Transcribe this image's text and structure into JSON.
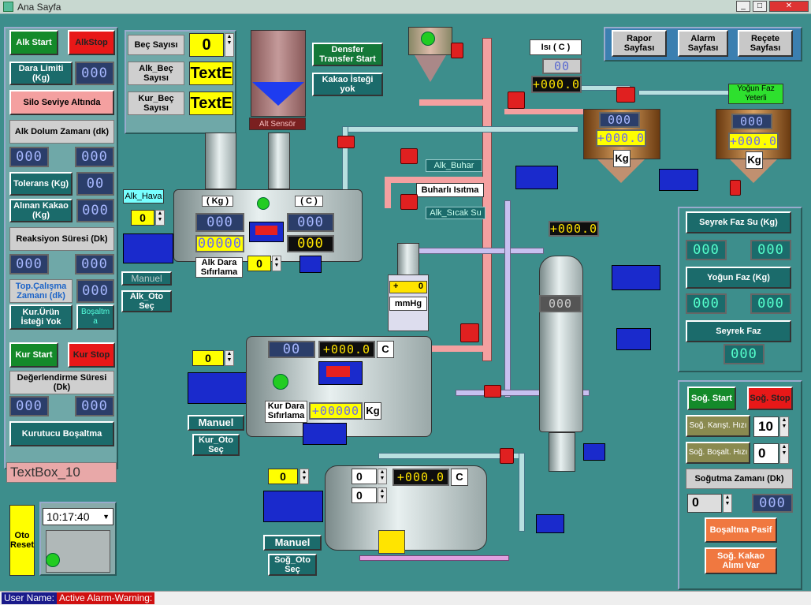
{
  "window": {
    "title": "Ana Sayfa",
    "min": "_",
    "max": "□",
    "close": "✕"
  },
  "left": {
    "alk_start": "Alk Start",
    "alk_stop": "AlkStop",
    "dara_limiti": "Dara Limiti (Kg)",
    "dara_limiti_val": "000",
    "silo_seviye": "Silo Seviye Altında",
    "alk_dolum": "Alk Dolum Zamanı (dk)",
    "alk_dolum_v1": "000",
    "alk_dolum_v2": "000",
    "tolerans": "Tolerans (Kg)",
    "tolerans_val": "00",
    "alinan_kakao": "Alınan Kakao (Kg)",
    "alinan_kakao_val": "000",
    "reaksiyon": "Reaksiyon Süresi (Dk)",
    "reaksiyon_v1": "000",
    "reaksiyon_v2": "000",
    "top_calisma": "Top.Çalışma Zamanı (dk)",
    "top_calisma_val": "000",
    "kur_urun": "Kur.Ürün İsteği Yok",
    "bosaltma_small": "Boşaltm a",
    "kur_start": "Kur Start",
    "kur_stop": "Kur Stop",
    "degerlendirme": "Değerlendirme Süresi (Dk)",
    "deger_v1": "000",
    "deger_v2": "000",
    "kurutucu": "Kurutucu Boşaltma",
    "textbox": "TextBox_10",
    "oto_reset": "Oto Reset",
    "time": "10:17:40"
  },
  "mid": {
    "bec_sayisi": "Beç Sayısı",
    "bec_val": "0",
    "alk_bec": "Alk_Beç Sayısı",
    "alk_bec_val": "TextE",
    "kur_bec": "Kur_Beç Sayısı",
    "kur_bec_val": "TextE",
    "alt_sensor": "Alt Sensör",
    "densfer": "Densfer Transfer Start",
    "kakao_istegi": "Kakao İsteği yok",
    "alk_hava": "Alk_Hava",
    "alk_hava_val": "0",
    "kg_label": "( Kg )",
    "c_label": "( C )",
    "kg_v1": "000",
    "kg_v2": "00000",
    "c_v1": "000",
    "c_v2": "000",
    "alk_dara": "Alk Dara Sıfırlama",
    "alk_dara_val": "0",
    "manuel1": "Manuel",
    "alk_oto": "Alk_Oto Seç",
    "alk_buhar": "Alk_Buhar",
    "buharli": "Buharlı Isıtma",
    "alk_sicak": "Alk_Sıcak Su",
    "mmhg_plus": "+",
    "mmhg_zero": "0",
    "mmhg": "mmHg",
    "kur_val": "0",
    "kur_v1": "00",
    "kur_temp": "+000.0",
    "kur_c": "C",
    "kur_dara": "Kur Dara Sıfırlama",
    "kur_weight": "+00000",
    "kur_kg": "Kg",
    "manuel2": "Manuel",
    "kur_oto": "Kur_Oto Seç",
    "sog_val": "0",
    "sog_v1": "0",
    "sog_v2": "0",
    "sog_temp": "+000.0",
    "sog_c": "C",
    "manuel3": "Manuel",
    "sog_oto": "Soğ_Oto Seç",
    "col_temp": "+000.0",
    "col_val": "000"
  },
  "right": {
    "rapor": "Rapor Sayfası",
    "alarm": "Alarm Sayfası",
    "recete": "Reçete Sayfası",
    "isi": "Isı ( C )",
    "isi_v1": "00",
    "isi_v2": "+000.0",
    "yogun_faz_yeterli": "Yoğun Faz Yeterli",
    "t1_v1": "000",
    "t1_v2": "+000.0",
    "t1_kg": "Kg",
    "t2_v1": "000",
    "t2_v2": "+000.0",
    "t2_kg": "Kg",
    "seyrek_su": "Seyrek Faz Su (Kg)",
    "seyrek_su_v1": "000",
    "seyrek_su_v2": "000",
    "yogun_faz": "Yoğun Faz (Kg)",
    "yogun_v1": "000",
    "yogun_v2": "000",
    "seyrek_faz": "Seyrek Faz",
    "seyrek_val": "000",
    "sog_start": "Soğ. Start",
    "sog_stop": "Soğ. Stop",
    "karist": "Soğ. Karışt. Hızı",
    "karist_val": "10",
    "bosalt": "Soğ. Boşalt. Hızı",
    "bosalt_val": "0",
    "sogutma": "Soğutma Zamanı (Dk)",
    "sogutma_v1": "0",
    "sogutma_v2": "000",
    "bosaltma_pasif": "Boşaltma Pasif",
    "sog_kakao": "Soğ. Kakao Alımı Var"
  },
  "status": {
    "user": "User Name:",
    "alarm": "Active Alarm-Warning:"
  }
}
